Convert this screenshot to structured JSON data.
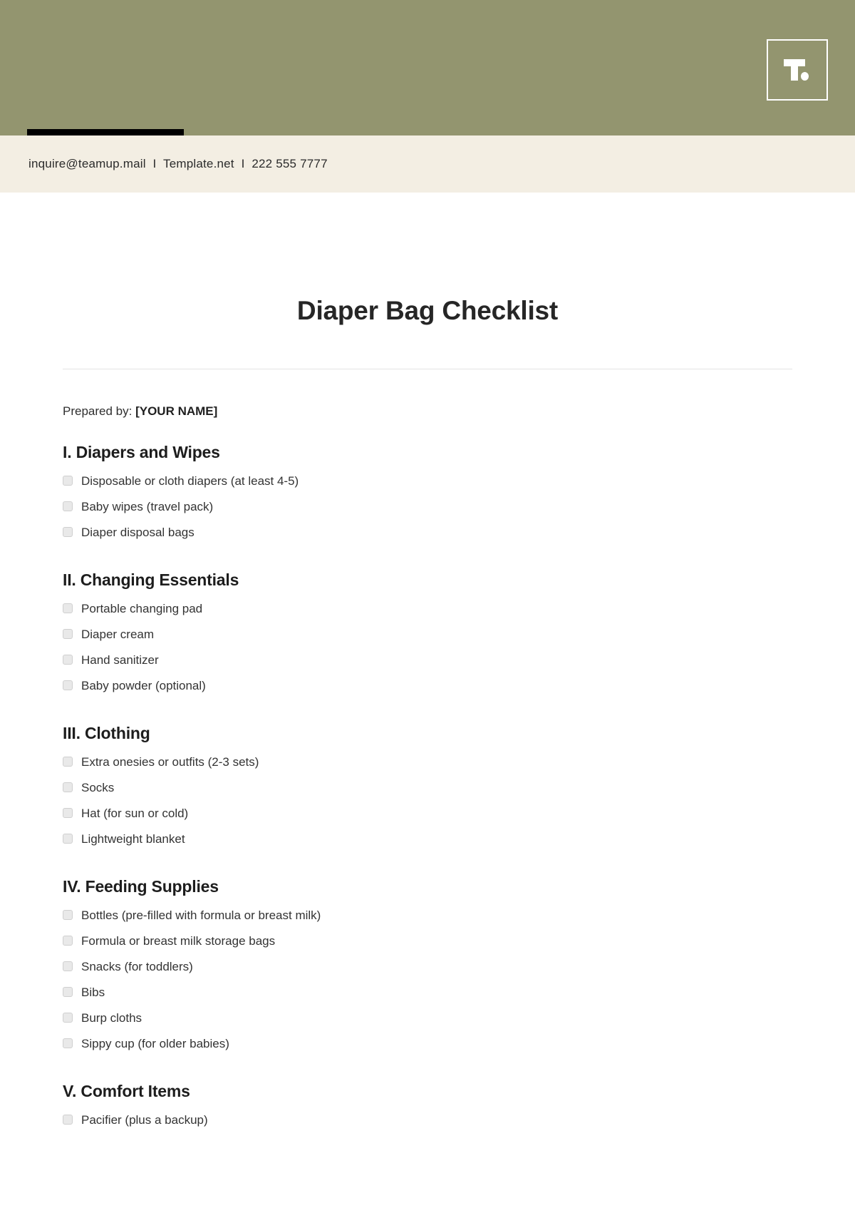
{
  "brand": {
    "logo_letter": "T",
    "header_color": "#93956F",
    "strip_color": "#F3EEE3",
    "accent_color": "#000000"
  },
  "contact": {
    "email": "inquire@teamup.mail",
    "separator": "I",
    "website": "Template.net",
    "phone": "222 555 7777",
    "line": "inquire@teamup.mail  I  Template.net  I  222 555 7777"
  },
  "document": {
    "title": "Diaper Bag Checklist",
    "prepared_by_label": "Prepared by:",
    "prepared_by_value": "[YOUR NAME]"
  },
  "sections": [
    {
      "heading": "I. Diapers and Wipes",
      "items": [
        "Disposable or cloth diapers (at least 4-5)",
        "Baby wipes (travel pack)",
        "Diaper disposal bags"
      ]
    },
    {
      "heading": "II. Changing Essentials",
      "items": [
        "Portable changing pad",
        "Diaper cream",
        "Hand sanitizer",
        "Baby powder (optional)"
      ]
    },
    {
      "heading": "III. Clothing",
      "items": [
        "Extra onesies or outfits (2-3 sets)",
        "Socks",
        "Hat (for sun or cold)",
        "Lightweight blanket"
      ]
    },
    {
      "heading": "IV. Feeding Supplies",
      "items": [
        "Bottles (pre-filled with formula or breast milk)",
        "Formula or breast milk storage bags",
        "Snacks (for toddlers)",
        "Bibs",
        "Burp cloths",
        "Sippy cup (for older babies)"
      ]
    },
    {
      "heading": "V. Comfort Items",
      "items": [
        "Pacifier (plus a backup)"
      ]
    }
  ]
}
